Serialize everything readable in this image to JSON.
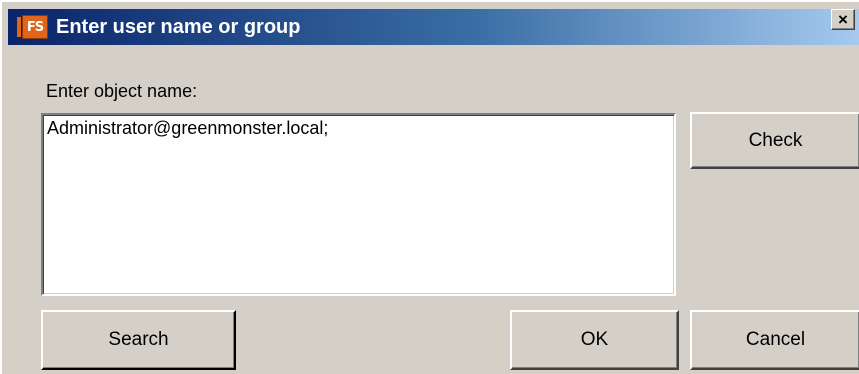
{
  "window": {
    "title": "Enter user name or group",
    "app_icon_text": "FS",
    "close_glyph": "×"
  },
  "form": {
    "label": "Enter object name:",
    "value": "Administrator@greenmonster.local;"
  },
  "buttons": {
    "check": "Check",
    "search": "Search",
    "ok": "OK",
    "cancel": "Cancel"
  },
  "icons": {
    "app_icon": "fs-app-icon",
    "close_icon": "close-icon"
  },
  "colors": {
    "titlebar_start": "#0a246a",
    "titlebar_end": "#a6caf0",
    "app_icon": "#e0651b",
    "dialog_background": "#d4d0c8"
  }
}
